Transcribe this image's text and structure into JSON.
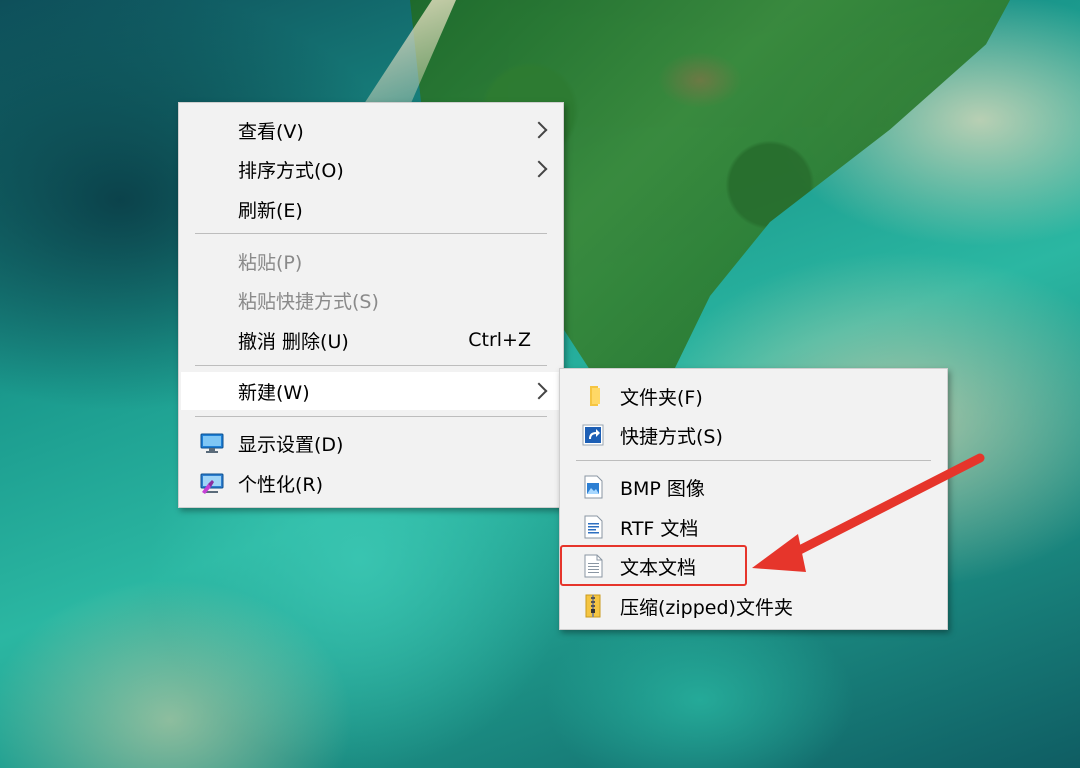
{
  "colors": {
    "menu_bg": "#f2f2f2",
    "highlight_bg": "#ffffff",
    "disabled_text": "#8a8a8a",
    "annotation_red": "#e6352b"
  },
  "context_menu": {
    "items": [
      {
        "label": "查看(V)",
        "has_submenu": true
      },
      {
        "label": "排序方式(O)",
        "has_submenu": true
      },
      {
        "label": "刷新(E)"
      },
      {
        "label": "粘贴(P)",
        "disabled": true
      },
      {
        "label": "粘贴快捷方式(S)",
        "disabled": true
      },
      {
        "label": "撤消 删除(U)",
        "shortcut": "Ctrl+Z"
      },
      {
        "label": "新建(W)",
        "has_submenu": true,
        "highlighted": true
      },
      {
        "label": "显示设置(D)",
        "icon": "display-settings-icon"
      },
      {
        "label": "个性化(R)",
        "icon": "personalize-icon"
      }
    ]
  },
  "new_submenu": {
    "items": [
      {
        "label": "文件夹(F)",
        "icon": "folder-icon"
      },
      {
        "label": "快捷方式(S)",
        "icon": "shortcut-icon"
      },
      {
        "label": "BMP 图像",
        "icon": "bmp-image-icon"
      },
      {
        "label": "RTF 文档",
        "icon": "rtf-document-icon"
      },
      {
        "label": "文本文档",
        "icon": "text-document-icon",
        "annotated": true
      },
      {
        "label": "压缩(zipped)文件夹",
        "icon": "zip-folder-icon"
      }
    ]
  }
}
